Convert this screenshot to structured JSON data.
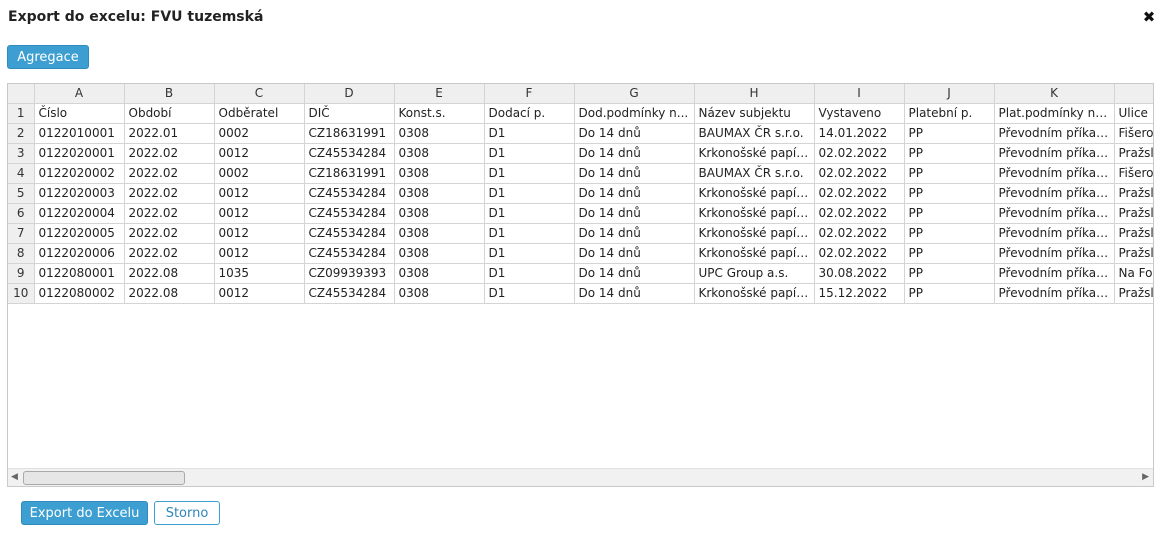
{
  "dialog": {
    "title": "Export do excelu: FVU tuzemská",
    "close_icon": "close-icon"
  },
  "toolbar": {
    "agregace_label": "Agregace"
  },
  "footer": {
    "export_label": "Export do Excelu",
    "storno_label": "Storno"
  },
  "grid": {
    "column_letters": [
      "A",
      "B",
      "C",
      "D",
      "E",
      "F",
      "G",
      "H",
      "I",
      "J",
      "K",
      ""
    ],
    "header_row": [
      "Číslo",
      "Období",
      "Odběratel",
      "DIČ",
      "Konst.s.",
      "Dodací p.",
      "Dod.podmínky n...",
      "Název subjektu",
      "Vystaveno",
      "Platební p.",
      "Plat.podmínky ná...",
      "Ulice"
    ],
    "rows": [
      [
        "0122010001",
        "2022.01",
        "0002",
        "CZ18631991",
        "0308",
        "D1",
        "Do 14 dnů",
        "BAUMAX ČR s.r.o.",
        "14.01.2022",
        "PP",
        "Převodním příkaz...",
        "Fišero"
      ],
      [
        "0122020001",
        "2022.02",
        "0012",
        "CZ45534284",
        "0308",
        "D1",
        "Do 14 dnů",
        "Krkonošské papír...",
        "02.02.2022",
        "PP",
        "Převodním příkaz...",
        "Pražsl"
      ],
      [
        "0122020002",
        "2022.02",
        "0002",
        "CZ18631991",
        "0308",
        "D1",
        "Do 14 dnů",
        "BAUMAX ČR s.r.o.",
        "02.02.2022",
        "PP",
        "Převodním příkaz...",
        "Fišero"
      ],
      [
        "0122020003",
        "2022.02",
        "0012",
        "CZ45534284",
        "0308",
        "D1",
        "Do 14 dnů",
        "Krkonošské papír...",
        "02.02.2022",
        "PP",
        "Převodním příkaz...",
        "Pražsl"
      ],
      [
        "0122020004",
        "2022.02",
        "0012",
        "CZ45534284",
        "0308",
        "D1",
        "Do 14 dnů",
        "Krkonošské papír...",
        "02.02.2022",
        "PP",
        "Převodním příkaz...",
        "Pražsl"
      ],
      [
        "0122020005",
        "2022.02",
        "0012",
        "CZ45534284",
        "0308",
        "D1",
        "Do 14 dnů",
        "Krkonošské papír...",
        "02.02.2022",
        "PP",
        "Převodním příkaz...",
        "Pražsl"
      ],
      [
        "0122020006",
        "2022.02",
        "0012",
        "CZ45534284",
        "0308",
        "D1",
        "Do 14 dnů",
        "Krkonošské papír...",
        "02.02.2022",
        "PP",
        "Převodním příkaz...",
        "Pražsl"
      ],
      [
        "0122080001",
        "2022.08",
        "1035",
        "CZ09939393",
        "0308",
        "D1",
        "Do 14 dnů",
        "UPC Group a.s.",
        "30.08.2022",
        "PP",
        "Převodním příkaz...",
        "Na Fo"
      ],
      [
        "0122080002",
        "2022.08",
        "0012",
        "CZ45534284",
        "0308",
        "D1",
        "Do 14 dnů",
        "Krkonošské papír...",
        "15.12.2022",
        "PP",
        "Převodním příkaz...",
        "Pražsl"
      ]
    ]
  },
  "scrollbar": {
    "left_arrow_icon": "caret-left-icon",
    "right_arrow_icon": "caret-right-icon"
  },
  "colors": {
    "accent": "#3d9fd1",
    "header_bg": "#efefef",
    "grid_border": "#d4d4d4"
  }
}
